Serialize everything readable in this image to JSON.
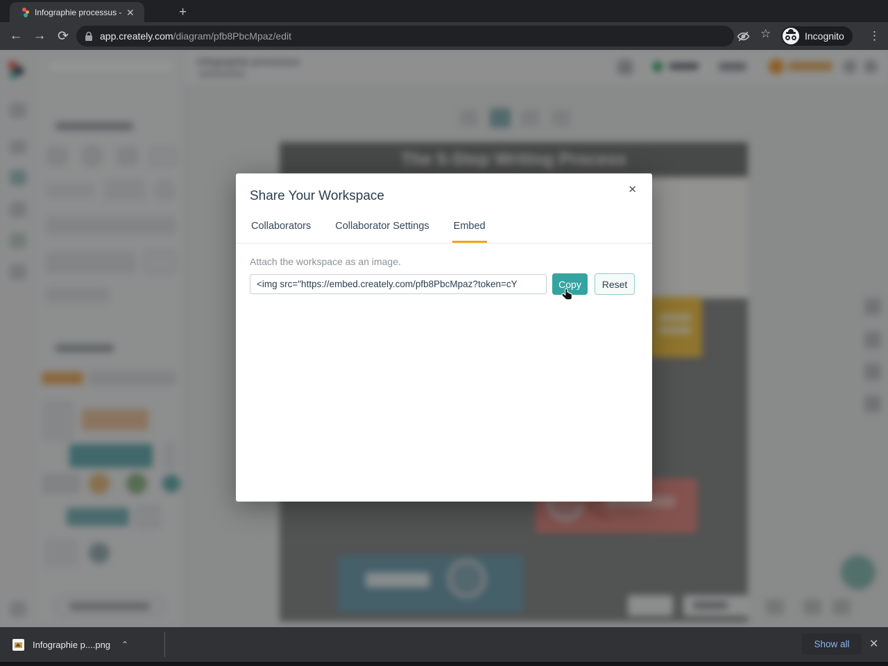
{
  "browser": {
    "tab_title": "Infographie processus - Cre",
    "tab_close_label": "✕",
    "new_tab_label": "+",
    "back_label": "←",
    "forward_label": "→",
    "reload_label": "⟳",
    "url_domain": "app.creately.com",
    "url_path": "/diagram/pfb8PbcMpaz/edit",
    "star_label": "☆",
    "incognito_label": "Incognito",
    "menu_label": "⋮"
  },
  "modal": {
    "title": "Share Your Workspace",
    "close_label": "✕",
    "tabs": [
      {
        "label": "Collaborators"
      },
      {
        "label": "Collaborator Settings"
      },
      {
        "label": "Embed"
      }
    ],
    "active_tab": "Embed",
    "description": "Attach the workspace as an image.",
    "embed_code": "<img src=\"https://embed.creately.com/pfb8PbcMpaz?token=cY",
    "copy_label": "Copy",
    "reset_label": "Reset"
  },
  "download_bar": {
    "file_name": "Infographie p....png",
    "chevron_label": "⌃",
    "show_all_label": "Show all",
    "close_label": "✕"
  },
  "background": {
    "doc_title": "Infographie processus",
    "canvas_title": "The 5-Step Writing Process"
  },
  "colors": {
    "active_tab_underline": "#f5a31b",
    "copy_button": "#35a4a0",
    "show_all_text": "#8ab4f8",
    "chrome_dark": "#202124",
    "toolbar_dark": "#35363a",
    "shelf_dark": "#313235"
  }
}
